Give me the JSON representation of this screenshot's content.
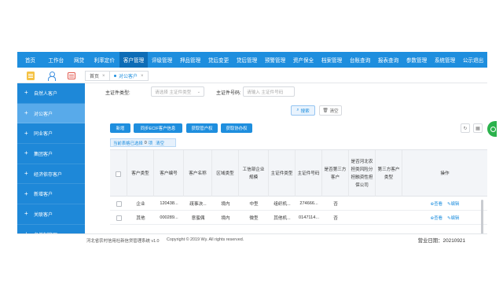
{
  "topnav": {
    "items": [
      "首页",
      "工作台",
      "网贷",
      "利率定价",
      "客户管理",
      "评级管理",
      "押品管理",
      "贷后变更",
      "贷后管理",
      "预警管理",
      "资产保全",
      "档案管理",
      "台账查询",
      "报表查询",
      "参数管理",
      "系统管理",
      "公示退出"
    ],
    "active_index": 4
  },
  "tabs": {
    "home": "首页",
    "current": "对公客户"
  },
  "sidebar": {
    "items": [
      {
        "label": "自然人客户"
      },
      {
        "label": "对公客户",
        "active": true
      },
      {
        "label": "同业客户"
      },
      {
        "label": "集团客户"
      },
      {
        "label": "经济依存客户"
      },
      {
        "label": "新增客户"
      },
      {
        "label": "关联客户"
      },
      {
        "label": "名单制管理",
        "expandable": true
      }
    ]
  },
  "filters": {
    "cert_type_label": "主证件类型:",
    "cert_type_placeholder": "请选择 主证件类型",
    "cert_no_label": "主证件号码:",
    "cert_no_placeholder": "请输入 主证件号码"
  },
  "buttons": {
    "search": "搜索",
    "clear": "清空",
    "add": "新增",
    "sync_ecif": "同步ECIF客户信息",
    "get_manage": "获取管户权",
    "get_assist": "获取协办权"
  },
  "selection": {
    "prefix": "当前表格已选择",
    "count": "0",
    "unit": "项",
    "clear": "清空"
  },
  "table": {
    "headers": [
      "客户类型",
      "客户编号",
      "客户名称",
      "区域类型",
      "工信部企业规模",
      "主证件类型",
      "主证件号码",
      "是否第三方客户",
      "是否河北农担类风险分担融资性担保公司",
      "第三方客户类型",
      "操作"
    ],
    "rows": [
      {
        "type": "企业",
        "no": "120438...",
        "name": "疏事决...",
        "region": "境内",
        "scale": "中型",
        "cert_type": "组织机...",
        "cert_no": "274666...",
        "third": "否",
        "hebei": "",
        "third_type": "",
        "ops": [
          "查看",
          "编辑"
        ]
      },
      {
        "type": "其他",
        "no": "000289...",
        "name": "意蜜偶",
        "region": "境内",
        "scale": "微型",
        "cert_type": "其他机...",
        "cert_no": "0147114...",
        "third": "否",
        "hebei": "",
        "third_type": "",
        "ops": [
          "查看",
          "编辑"
        ]
      }
    ]
  },
  "footer": {
    "system": "河北省农村信用社新信贷管理系统 v1.0",
    "copyright": "Copyright © 2019 Wy. All rights reserved.",
    "business_date": "营业日期：20210921"
  },
  "colors": {
    "primary": "#1e8ede",
    "sidebar": "#1e88d8",
    "sidebar_active": "#58aaea"
  }
}
